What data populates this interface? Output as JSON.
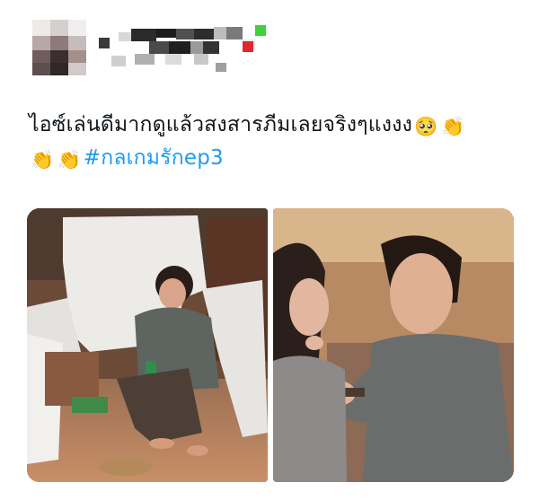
{
  "tweet": {
    "text_line1": "ไอซ์เล่นดีมากดูแล้วสงสารภีมเลยจริงๆแงงง",
    "emoji_pleading": "🥺",
    "emoji_clap1": "👏",
    "emoji_clap2": "👏",
    "emoji_clap3": "👏",
    "hashtag": "#กลเกมรักep3"
  },
  "colors": {
    "text": "#0f1419",
    "hashtag": "#1d9bf0"
  }
}
